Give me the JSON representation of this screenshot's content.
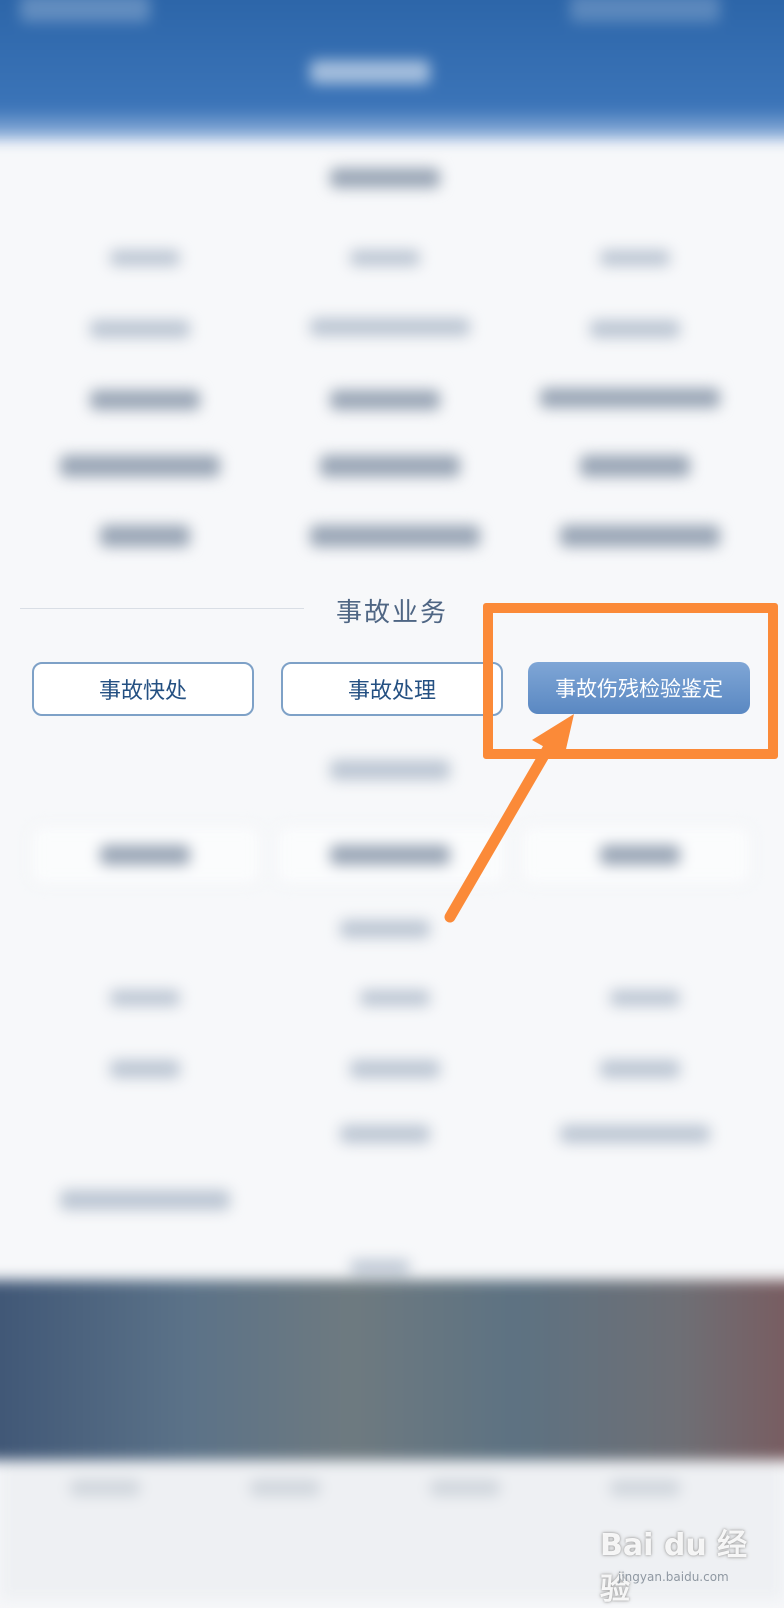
{
  "section": {
    "title": "事故业务"
  },
  "buttons": [
    {
      "label": "事故快处"
    },
    {
      "label": "事故处理"
    },
    {
      "label": "事故伤残检验鉴定"
    }
  ],
  "annotation": {
    "color": "#fb8a38"
  },
  "watermark": {
    "brand": "Bai du 经验",
    "url": "jingyan.baidu.com"
  }
}
